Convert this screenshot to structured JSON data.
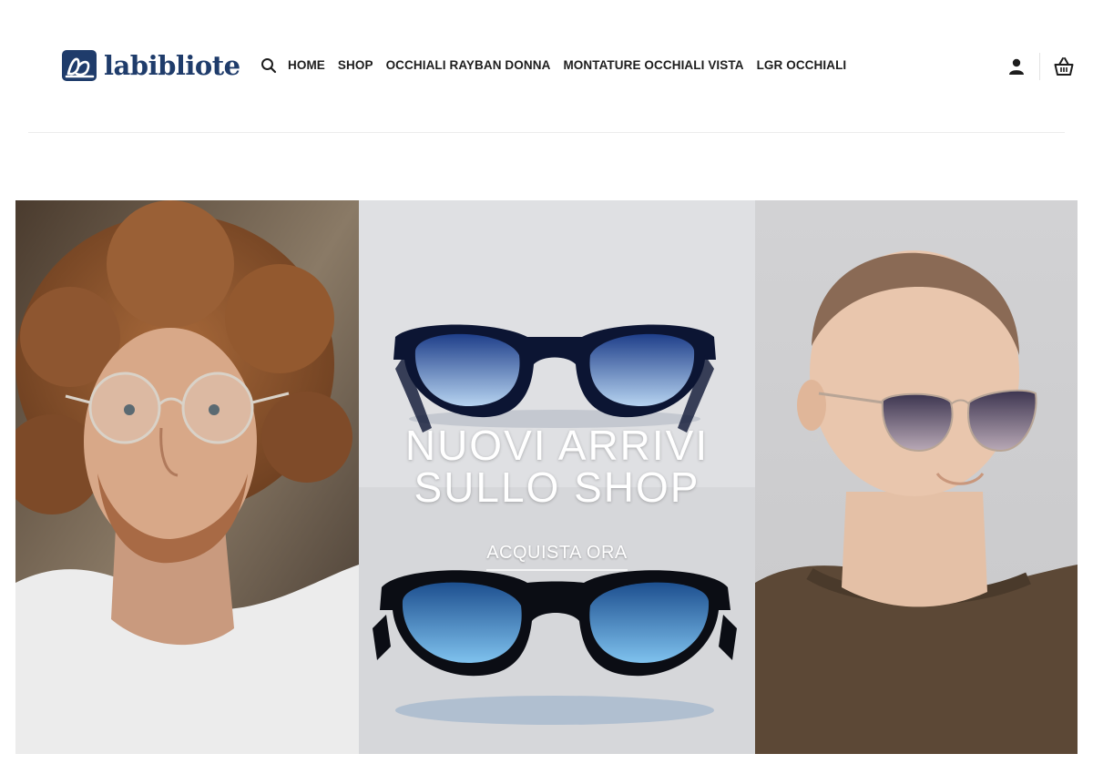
{
  "brand": {
    "name": "labibliote",
    "logo_icon": "lb-monogram-logo",
    "color": "#1f3c6b"
  },
  "nav": {
    "search_icon": "search-icon",
    "items": [
      {
        "label": "HOME"
      },
      {
        "label": "SHOP"
      },
      {
        "label": "OCCHIALI RAYBAN DONNA"
      },
      {
        "label": "MONTATURE OCCHIALI VISTA"
      },
      {
        "label": "LGR OCCHIALI"
      }
    ]
  },
  "header_actions": {
    "account_icon": "user-icon",
    "cart_icon": "basket-icon"
  },
  "hero": {
    "title_line1": "NUOVI ARRIVI",
    "title_line2": "SULLO SHOP",
    "cta_label": "ACQUISTA ORA",
    "images": [
      {
        "subject": "curly-haired man wearing round eyeglasses"
      },
      {
        "subject": "two pairs of dark sunglasses with blue lenses"
      },
      {
        "subject": "shaved-head man wearing cat-eye sunglasses"
      }
    ]
  },
  "colors": {
    "text": "#1d1d1d",
    "divider": "#ececec",
    "hero_text": "#ffffff"
  }
}
